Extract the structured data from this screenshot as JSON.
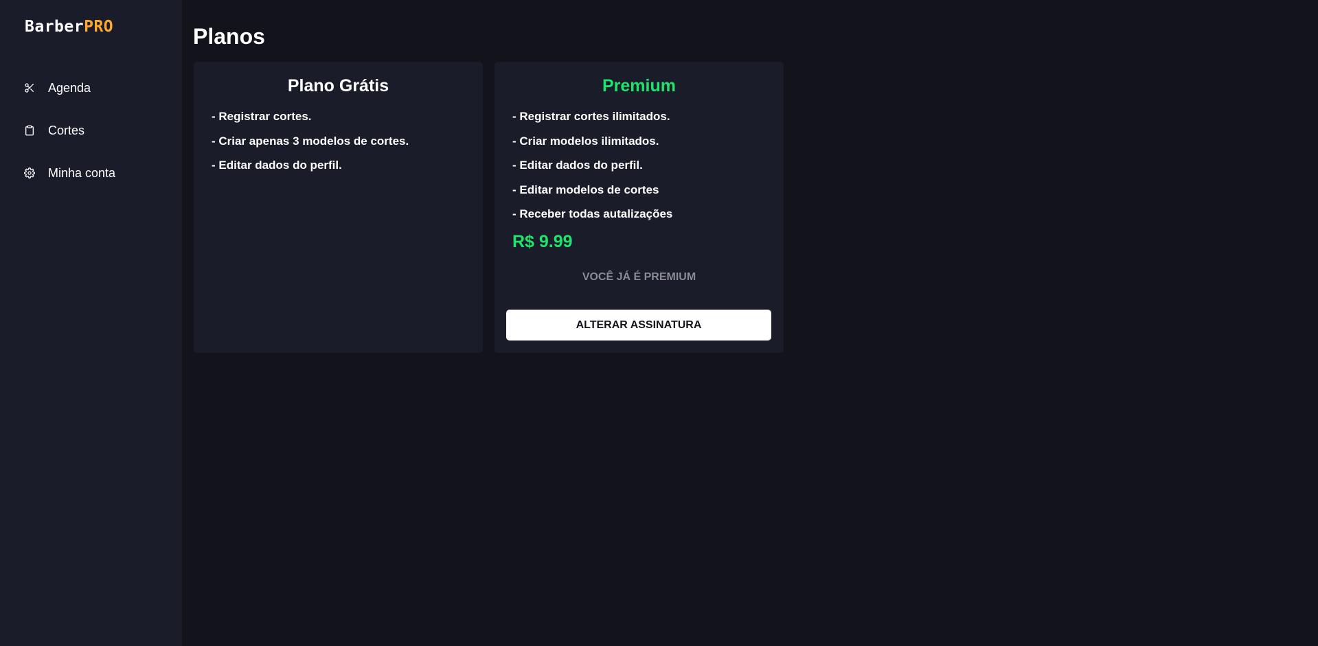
{
  "logo": {
    "part1": "Barber",
    "part2": "PRO"
  },
  "sidebar": {
    "items": [
      {
        "label": "Agenda",
        "icon": "scissors-icon"
      },
      {
        "label": "Cortes",
        "icon": "clipboard-icon"
      },
      {
        "label": "Minha conta",
        "icon": "gear-icon"
      }
    ]
  },
  "page": {
    "title": "Planos"
  },
  "plans": {
    "free": {
      "title": "Plano Grátis",
      "features": [
        "- Registrar cortes.",
        "- Criar apenas 3 modelos de cortes.",
        "- Editar dados do perfil."
      ]
    },
    "premium": {
      "title": "Premium",
      "features": [
        "- Registrar cortes ilimitados.",
        "- Criar modelos ilimitados.",
        "- Editar dados do perfil.",
        "- Editar modelos de cortes",
        "- Receber todas autalizações"
      ],
      "price": "R$ 9.99",
      "status": "VOCÊ JÁ É PREMIUM",
      "button_label": "ALTERAR ASSINATURA"
    }
  },
  "colors": {
    "background": "#12131b",
    "panel": "#1b1c29",
    "accent_orange": "#fba931",
    "accent_green": "#1fe36c",
    "muted": "#8a8b93"
  }
}
